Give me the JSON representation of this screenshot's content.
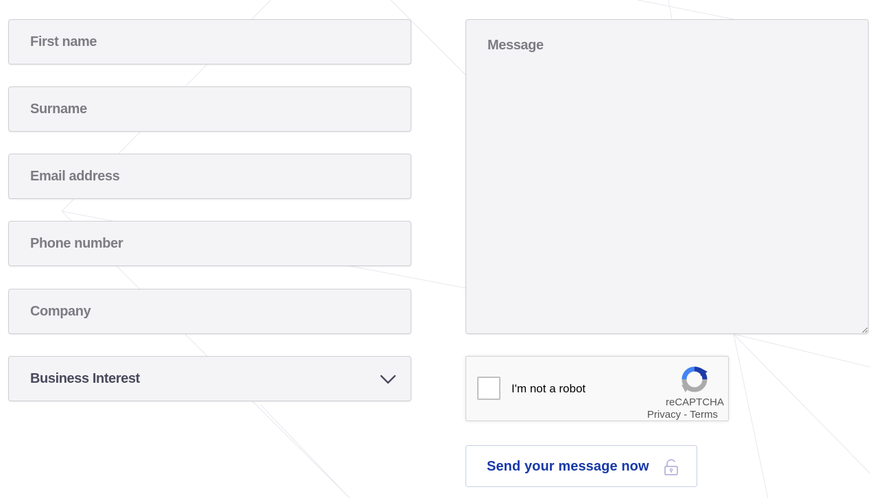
{
  "form": {
    "first_name": {
      "placeholder": "First name",
      "value": ""
    },
    "surname": {
      "placeholder": "Surname",
      "value": ""
    },
    "email": {
      "placeholder": "Email address",
      "value": ""
    },
    "phone": {
      "placeholder": "Phone number",
      "value": ""
    },
    "company": {
      "placeholder": "Company",
      "value": ""
    },
    "business_interest": {
      "selected": "Business Interest",
      "icon": "chevron-down-icon"
    },
    "message": {
      "placeholder": "Message",
      "value": ""
    }
  },
  "recaptcha": {
    "label": "I'm not a robot",
    "brand": "reCAPTCHA",
    "privacy": "Privacy",
    "separator": " - ",
    "terms": "Terms",
    "checked": false,
    "colors": {
      "blue": "#1c3aa9",
      "light_blue": "#4285f4",
      "gray": "#ababab"
    }
  },
  "send": {
    "label": "Send your message now",
    "icon": "lock-icon"
  },
  "colors": {
    "field_bg": "#f4f3f6",
    "field_border": "#cfcfd4",
    "placeholder_text": "#7c7c82",
    "accent": "#1739a8"
  }
}
